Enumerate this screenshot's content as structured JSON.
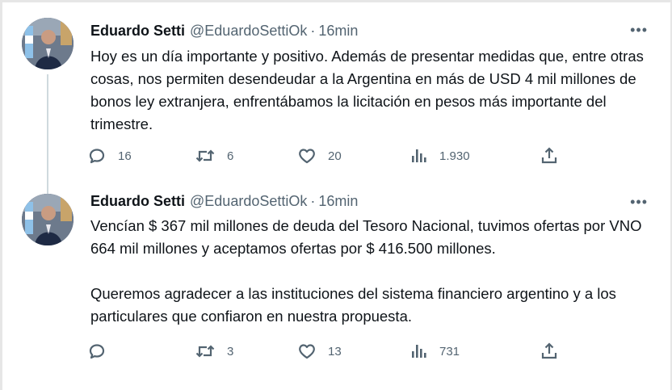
{
  "tweets": [
    {
      "author_name": "Eduardo Setti",
      "handle": "@EduardoSettiOk",
      "separator": "·",
      "time": "16min",
      "more_label": "•••",
      "paragraphs": [
        "Hoy es un día importante y positivo. Además de presentar medidas que, entre otras cosas, nos permiten desendeudar a la Argentina en más de USD 4 mil millones de bonos ley extranjera, enfrentábamos la licitación en pesos más importante del trimestre."
      ],
      "replies": "16",
      "retweets": "6",
      "likes": "20",
      "views": "1.930"
    },
    {
      "author_name": "Eduardo Setti",
      "handle": "@EduardoSettiOk",
      "separator": "·",
      "time": "16min",
      "more_label": "•••",
      "paragraphs": [
        "Vencían $ 367 mil millones de deuda del Tesoro Nacional, tuvimos ofertas por VNO 664 mil millones y aceptamos ofertas por $ 416.500 millones.",
        "Queremos agradecer a las instituciones del sistema financiero argentino y a los particulares que confiaron en nuestra propuesta."
      ],
      "replies": "",
      "retweets": "3",
      "likes": "13",
      "views": "731"
    }
  ],
  "icons": {
    "reply": "reply-icon",
    "retweet": "retweet-icon",
    "like": "like-icon",
    "views": "views-icon",
    "share": "share-icon",
    "more": "more-icon"
  },
  "colors": {
    "text_primary": "#0f1419",
    "text_secondary": "#536471",
    "thread_line": "#cfd9de"
  }
}
